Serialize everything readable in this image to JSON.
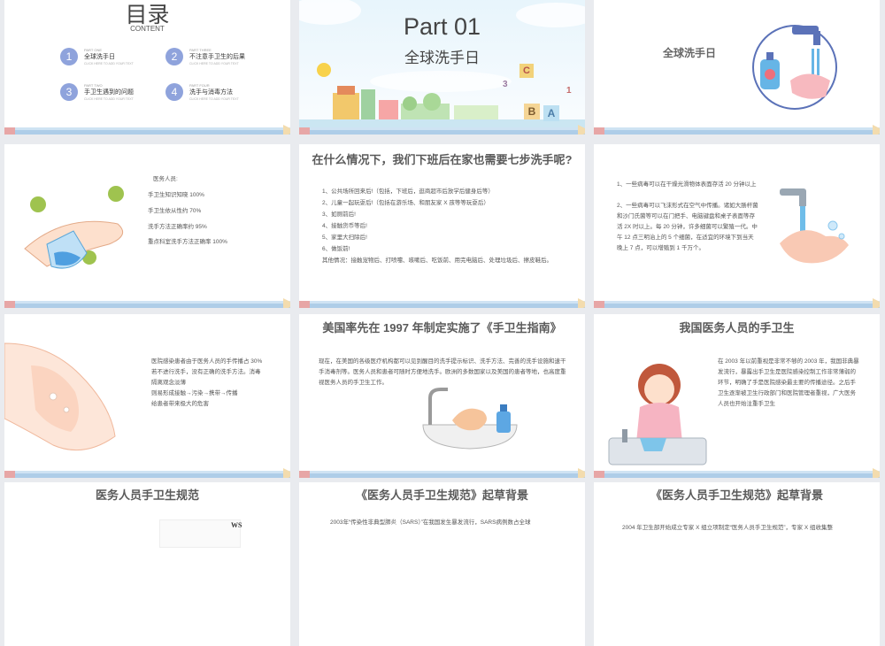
{
  "slide1": {
    "title": "目录",
    "subtitle": "CONTENT",
    "items": [
      {
        "num": "1",
        "tag": "PART ONE",
        "name": "全球洗手日",
        "sub": "CLICK HERE TO ADD YOUR TEXT"
      },
      {
        "num": "2",
        "tag": "PART THREE",
        "name": "不注意手卫生的后果",
        "sub": "CLICK HERE TO ADD YOUR TEXT"
      },
      {
        "num": "3",
        "tag": "PART TWO",
        "name": "手卫生遇到的问题",
        "sub": "CLICK HERE TO ADD YOUR TEXT"
      },
      {
        "num": "4",
        "tag": "PART FOUR",
        "name": "洗手与消毒方法",
        "sub": "CLICK HERE TO ADD YOUR TEXT"
      }
    ]
  },
  "slide2": {
    "part": "Part 01",
    "title": "全球洗手日",
    "blocks": [
      "C",
      "3",
      "1",
      "B",
      "A"
    ]
  },
  "slide3": {
    "title": "全球洗手日"
  },
  "slide4": {
    "lines": [
      "医务人员:",
      "手卫生知识知晓 100%",
      "手卫生依从性约 70%",
      "洗手方法正确率约 95%",
      "重点科室洗手方法正确率 100%"
    ]
  },
  "slide5": {
    "title": "在什么情况下，我们下班后在家也需要七步洗手呢?",
    "lines": [
      "1、公共场所回来后!（包括，下班后，逛商超市后放学后健身后等）",
      "2、儿童一起玩耍后!（包括在游乐场、和朋友家 X 孩等等玩耍后）",
      "3、如厕前后!",
      "4、接触货币等后!",
      "5、家里大扫除后!",
      "6、做饭前!",
      "其他情况：接触宠物后、打喷嚏、咳嗽后、吃饭前、用完电脑后、处理垃圾后、擦皮鞋后。"
    ]
  },
  "slide6": {
    "text": "1、一些病毒可以在干燥光滑物体表面存活 20 分钟以上\n\n2、一些病毒可以飞沫形式在空气中传播。诸如大肠杆菌和沙门氏菌等可以在门把手、电脑键盘和桌子表面等存活 2X 时以上。每 20 分钟，许多细菌可以繁殖一代。中午 12 点三明治上的 5 个细菌，在适宜的环境下到当天晚上 7 点，可以增殖到 1 千万个。"
  },
  "slide7": {
    "text": "医院感染患者由于医务人员的手传播占 30% 若不进行洗手，没有正确的洗手方法。消毒隔离观念淡薄\n则易形成接触→污染→携带→传播\n给患者带来极大的危害"
  },
  "slide8": {
    "title": "美国率先在 1997 年制定实施了《手卫生指南》",
    "text": "现在，在美国的各级医疗机构都可以见到醒目的洗手提示标识、洗手方法、完善的洗手设施和速干手消毒剂等。医务人员和患者可随时方便地洗手。欧洲的多数国家以及美国的患者等地，也高度重视医务人员的手卫生工作。"
  },
  "slide9": {
    "title": "我国医务人员的手卫生",
    "text": "在 2003 年以前重视是非常不够的 2003 年，我国非典暴发流行，暴露出手卫生是医院感染控制工作非常薄弱的环节，明确了手是医院感染最主要的传播途径。之后手卫生逐渐被卫生行政部门和医院管理者重视，广大医务人员也开始注重手卫生"
  },
  "slide10": {
    "title": "医务人员手卫生规范",
    "mark": "WS"
  },
  "slide11": {
    "title": "《医务人员手卫生规范》起草背景",
    "text": "2003年“传染性非典型肺炎（SARS）”在我国发生暴发流行，SARS病例数占全球"
  },
  "slide12": {
    "title": "《医务人员手卫生规范》起草背景",
    "text": "2004 年卫生部开始成立专家 X 组立项制定“医务人员手卫生规范”，专家 X 组收集整"
  }
}
